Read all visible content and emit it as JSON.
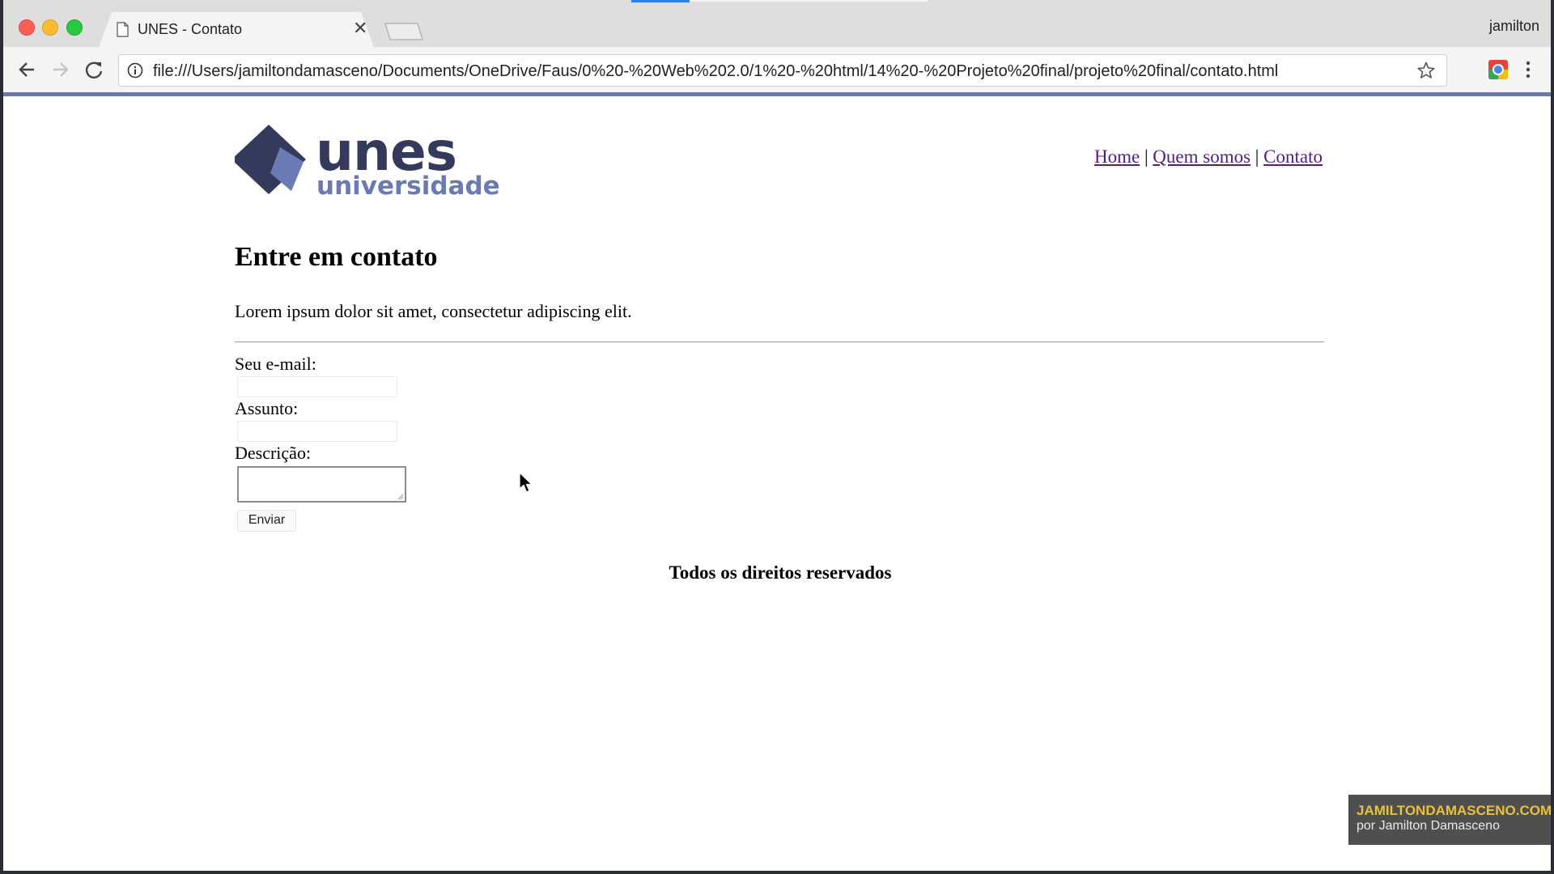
{
  "browser": {
    "tab_title": "UNES - Contato",
    "profile_name": "jamilton",
    "url": "file:///Users/jamiltondamasceno/Documents/OneDrive/Faus/0%20-%20Web%202.0/1%20-%20html/14%20-%20Projeto%20final/projeto%20final/contato.html",
    "icons": [
      "back-icon",
      "forward-icon",
      "reload-icon",
      "info-icon",
      "bookmark-star-icon",
      "extension-icon",
      "menu-icon",
      "close-icon",
      "page-icon"
    ]
  },
  "site": {
    "logo_text_main": "unes",
    "logo_text_sub": "universidade",
    "brand_colors": {
      "dark": "#343a5c",
      "light": "#6a7ab4"
    },
    "nav": [
      {
        "label": "Home"
      },
      {
        "label": "Quem somos"
      },
      {
        "label": "Contato"
      }
    ],
    "nav_separator": "|"
  },
  "content": {
    "heading": "Entre em contato",
    "intro": "Lorem ipsum dolor sit amet, consectetur adipiscing elit.",
    "form": {
      "email_label": "Seu e-mail:",
      "email_value": "",
      "subject_label": "Assunto:",
      "subject_value": "",
      "description_label": "Descrição:",
      "description_value": "",
      "submit_label": "Enviar"
    },
    "footer": "Todos os direitos reservados"
  },
  "watermark": {
    "line1": "JAMILTONDAMASCENO.COM",
    "line2": "por Jamilton Damasceno"
  }
}
